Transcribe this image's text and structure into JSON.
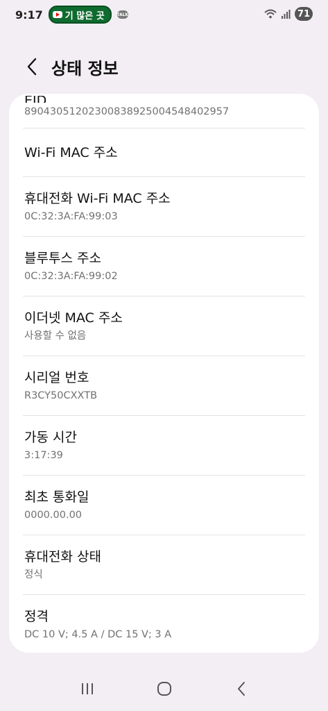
{
  "status": {
    "time": "9:17",
    "notif_text": "기 많은 곳",
    "talk_label": "TALK",
    "battery": "71"
  },
  "header": {
    "title": "상태 정보"
  },
  "items": [
    {
      "title": "EID",
      "value": "89043051202300838925004548402957"
    },
    {
      "title": "Wi-Fi MAC 주소",
      "value": ""
    },
    {
      "title": "휴대전화 Wi-Fi MAC 주소",
      "value": "0C:32:3A:FA:99:03"
    },
    {
      "title": "블루투스 주소",
      "value": "0C:32:3A:FA:99:02"
    },
    {
      "title": "이더넷 MAC 주소",
      "value": "사용할 수 없음"
    },
    {
      "title": "시리얼 번호",
      "value": "R3CY50CXXTB"
    },
    {
      "title": "가동 시간",
      "value": "3:17:39"
    },
    {
      "title": "최초 통화일",
      "value": "0000.00.00"
    },
    {
      "title": "휴대전화 상태",
      "value": "정식"
    },
    {
      "title": "정격",
      "value": "DC 10 V; 4.5 A / DC 15 V; 3 A"
    }
  ]
}
